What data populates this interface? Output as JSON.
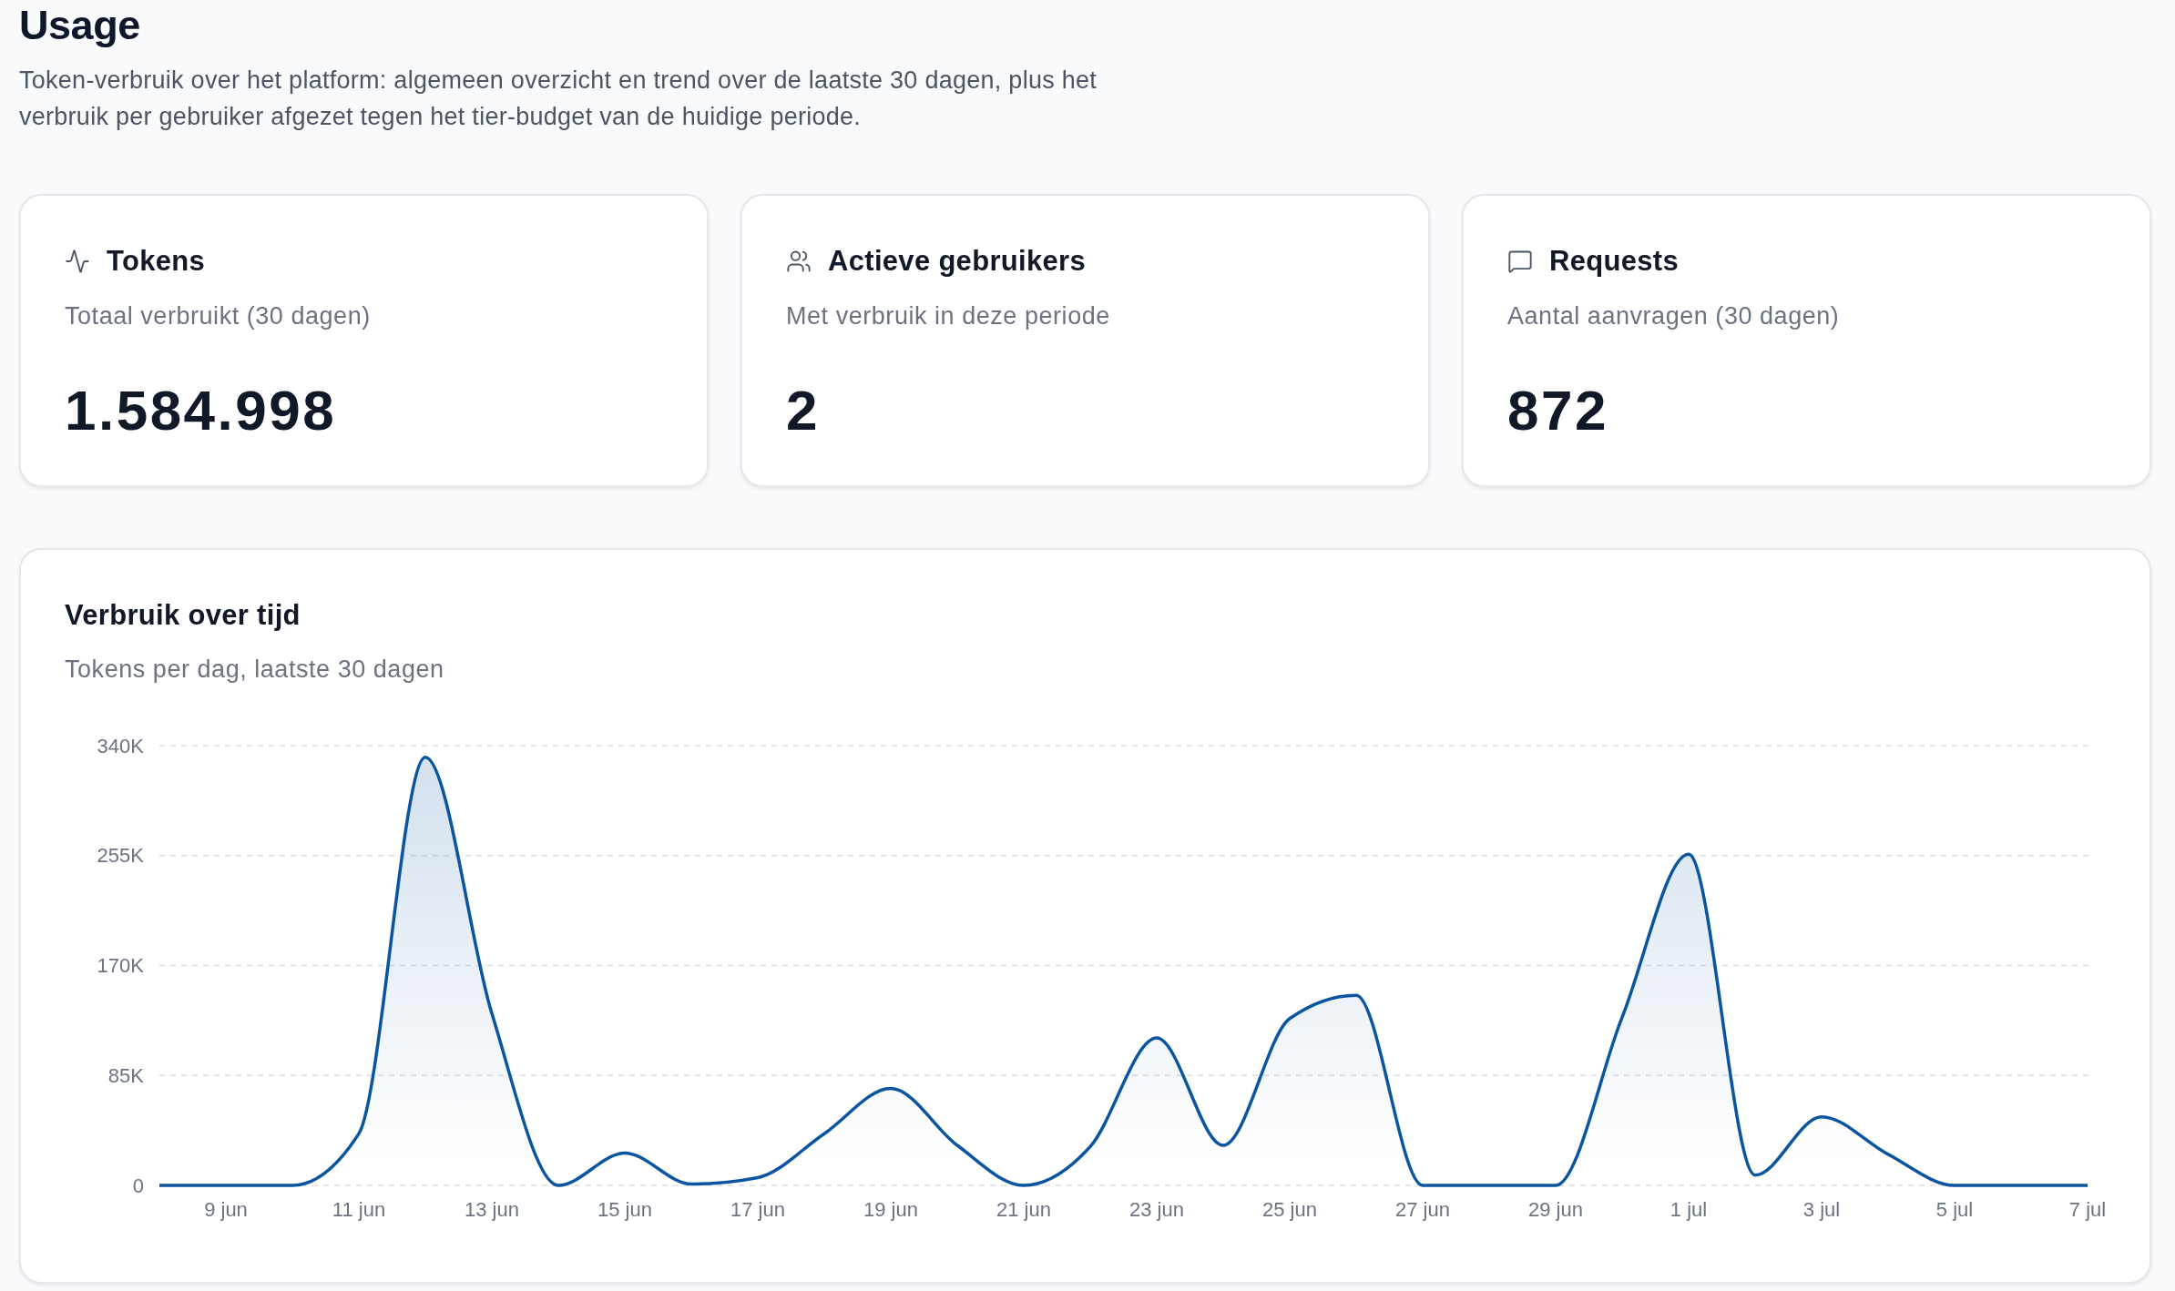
{
  "page": {
    "title": "Usage",
    "description": "Token-verbruik over het platform: algemeen overzicht en trend over de laatste 30 dagen, plus het verbruik per gebruiker afgezet tegen het tier-budget van de huidige periode."
  },
  "stat_cards": [
    {
      "kind": "tokens",
      "title": "Tokens",
      "subtitle": "Totaal verbruikt (30 dagen)",
      "value": "1.584.998"
    },
    {
      "kind": "users",
      "title": "Actieve gebruikers",
      "subtitle": "Met verbruik in deze periode",
      "value": "2"
    },
    {
      "kind": "requests",
      "title": "Requests",
      "subtitle": "Aantal aanvragen (30 dagen)",
      "value": "872"
    }
  ],
  "usage_chart": {
    "title": "Verbruik over tijd",
    "subtitle": "Tokens per dag, laatste 30 dagen",
    "chart_data": {
      "type": "area",
      "categories": [
        null,
        "9 jun",
        null,
        "11 jun",
        null,
        "13 jun",
        null,
        "15 jun",
        null,
        "17 jun",
        null,
        "19 jun",
        null,
        "21 jun",
        null,
        "23 jun",
        null,
        "25 jun",
        null,
        "27 jun",
        null,
        "29 jun",
        null,
        "1 jul",
        null,
        "3 jul",
        null,
        "5 jul",
        null,
        "7 jul"
      ],
      "series": [
        {
          "color": "#0b55a0",
          "values": [
            0,
            0,
            0,
            40000,
            331000,
            133000,
            0,
            25000,
            1000,
            6000,
            40000,
            75000,
            31000,
            0,
            30000,
            114000,
            31000,
            129000,
            147000,
            0,
            0,
            0,
            130000,
            256000,
            8000,
            53000,
            24000,
            0,
            0,
            0
          ]
        }
      ],
      "ylim": [
        0,
        340000
      ],
      "yticks": [
        {
          "value": 0,
          "label": "0"
        },
        {
          "value": 85000,
          "label": "85K"
        },
        {
          "value": 170000,
          "label": "170K"
        },
        {
          "value": 255000,
          "label": "255K"
        },
        {
          "value": 340000,
          "label": "340K"
        }
      ],
      "grid": true
    }
  }
}
